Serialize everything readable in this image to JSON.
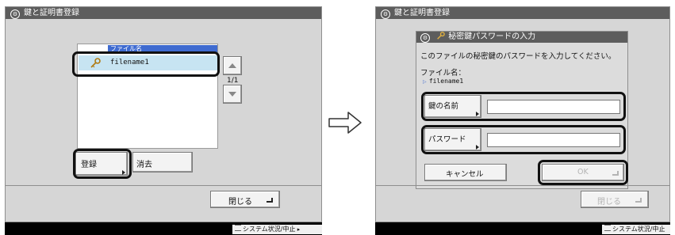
{
  "screen1": {
    "title": "鍵と証明書登録",
    "list_header": "ファイル名",
    "file_item": "filename1",
    "page_indicator": "1/1",
    "register_button": "登録",
    "delete_button": "消去",
    "close_button": "閉じる",
    "system_status_button": "システム状況/中止"
  },
  "screen2": {
    "title": "鍵と証明書登録",
    "dialog_title": "秘密鍵パスワードの入力",
    "message": "このファイルの秘密鍵のパスワードを入力してください。",
    "filename_label": "ファイル名：",
    "filename_value": "filename1",
    "key_name_button": "鍵の名前",
    "key_name_value": "",
    "password_button": "パスワード",
    "password_value": "",
    "cancel_button": "キャンセル",
    "ok_button": "OK",
    "close_button": "閉じる",
    "system_status_button": "システム状況/中止"
  },
  "arrow": {
    "icon": "arrow-right-icon"
  },
  "colors": {
    "screen_bg": "#d6d6d6",
    "title_bg": "#5d5d5d",
    "list_header_bg": "#3f6bd0",
    "selected_row_bg": "#c7e4f2",
    "bottom_bar": "#000000",
    "disabled_text": "#b4b4b4"
  }
}
